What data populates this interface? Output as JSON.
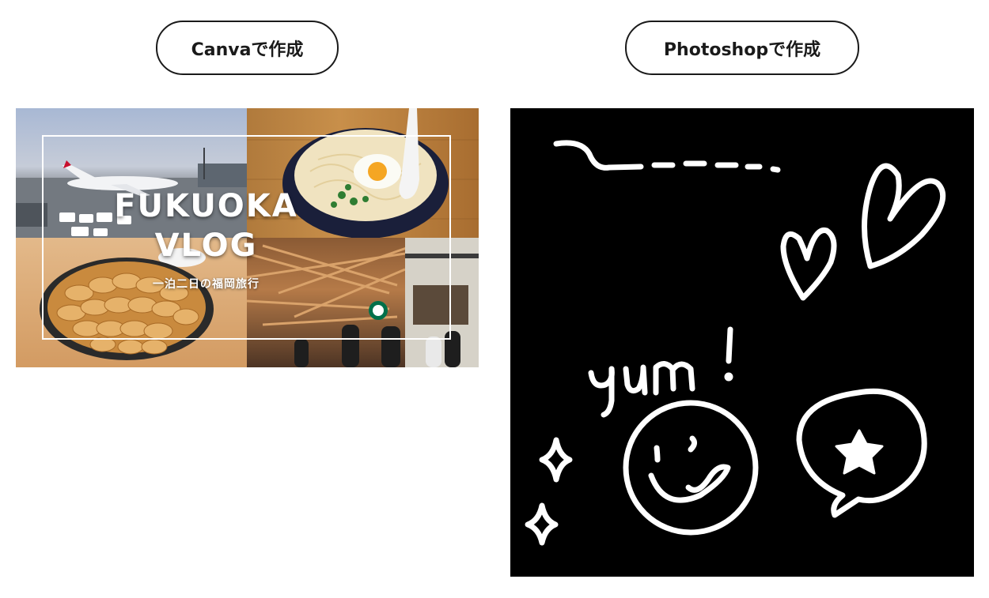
{
  "labels": {
    "canva": "Canvaで作成",
    "photoshop": "Photoshopで作成"
  },
  "canva_thumbnail": {
    "title_line1": "FUKUOKA",
    "title_line2": "VLOG",
    "subtitle": "一泊二日の福岡旅行",
    "photos": [
      "airport",
      "udon-with-egg",
      "gyoza-pan",
      "starbucks-dazaifu"
    ]
  },
  "photoshop_art": {
    "handwritten_text": "yum !",
    "background_color": "#000000",
    "stroke_color": "#ffffff",
    "doodles": [
      "dash-line",
      "heart-large",
      "heart-small",
      "smiley-face",
      "star-speech-bubble",
      "sparkles"
    ]
  }
}
